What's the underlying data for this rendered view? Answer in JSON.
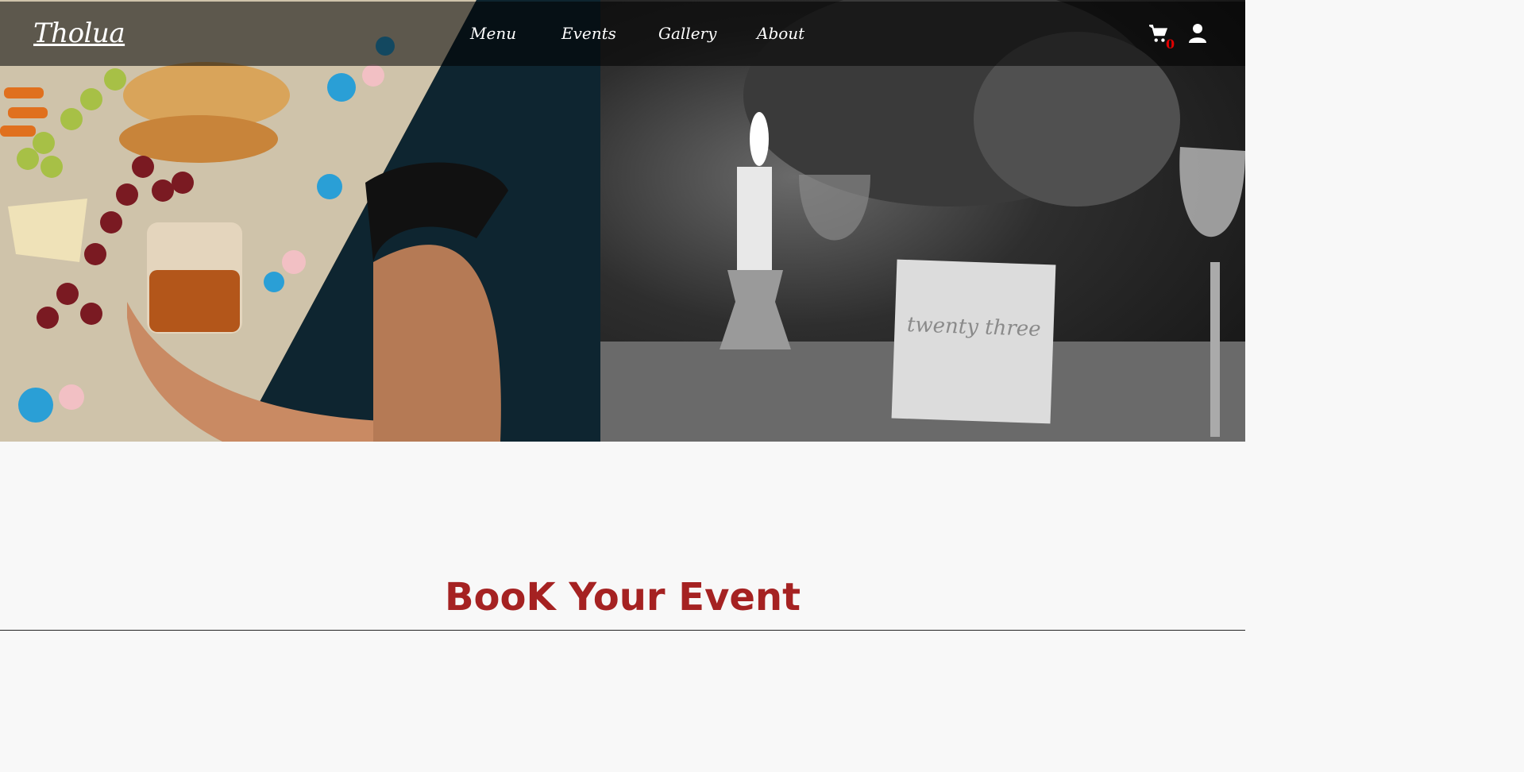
{
  "brand": {
    "logo_text": "Tholua"
  },
  "nav": {
    "links": [
      {
        "label": "Menu"
      },
      {
        "label": "Events"
      },
      {
        "label": "Gallery"
      },
      {
        "label": "About"
      }
    ],
    "cart_count": "0",
    "cart_icon": "shopping-cart-icon",
    "user_icon": "user-icon"
  },
  "hero": {
    "left_image": "food-table-with-whiskey-glass",
    "right_image": "grayscale-candlelit-dinner-table",
    "table_card_text": "twenty three"
  },
  "section": {
    "title": "BooK Your Event"
  },
  "colors": {
    "accent": "#a52222",
    "badge": "#e00000",
    "nav_bg": "rgba(0,0,0,0.55)"
  }
}
